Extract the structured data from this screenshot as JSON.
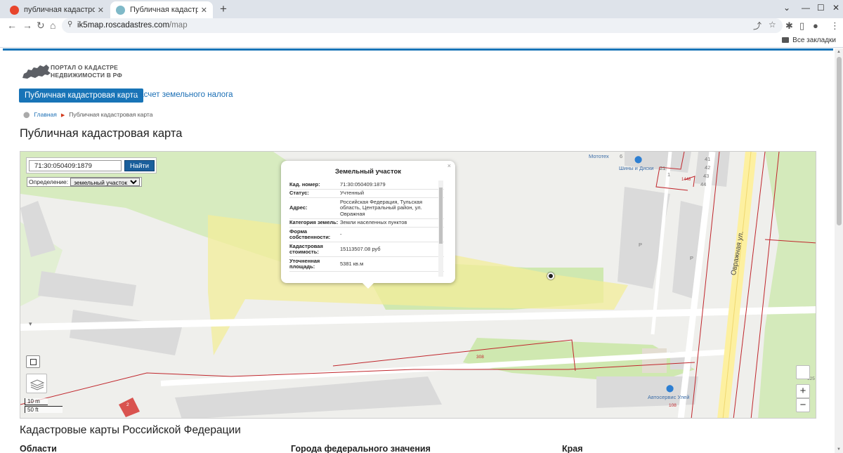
{
  "browser": {
    "tabs": [
      {
        "title": "публичная кадастровая ка",
        "active": false
      },
      {
        "title": "Публичная кадастровая ка",
        "active": true
      }
    ],
    "url_host": "ik5map.roscadastres.com",
    "url_path": "/map",
    "bookmarks_label": "Все закладки"
  },
  "site": {
    "logo_line1": "ПОРТАЛ О КАДАСТРЕ",
    "logo_line2": "НЕДВИЖИМОСТИ В РФ",
    "nav": [
      "Публичная кадастровая карта",
      "Расчет земельного налога"
    ],
    "breadcrumb": {
      "home": "Главная",
      "current": "Публичная кадастровая карта"
    },
    "title": "Публичная кадастровая карта"
  },
  "map": {
    "search_value": "71:30:050409:1879",
    "search_button": "Найти",
    "definition_label": "Определение:",
    "definition_selected": "земельный участок",
    "scale_m": "10 m",
    "scale_ft": "50 ft",
    "zoom_in": "+",
    "zoom_out": "−",
    "labels": {
      "shop1": "Мототех",
      "shop2": "Шины и Диски",
      "n6": "6",
      "n21": "21",
      "n1": "1",
      "n41": "41",
      "n42": "42",
      "n43": "43",
      "n44": "44",
      "n1448": "1448",
      "p1": "P",
      "p2": "P",
      "street": "Овражная ул.",
      "n308": "308",
      "n2": "2",
      "n125": "125",
      "n108": "108",
      "autoservice": "Автосервис Улей"
    },
    "popup": {
      "title": "Земельный участок",
      "close": "×",
      "rows": [
        {
          "key": "Кад. номер:",
          "value": "71:30:050409:1879"
        },
        {
          "key": "Статус:",
          "value": "Учтенный"
        },
        {
          "key": "Адрес:",
          "value": "Российская Федерация, Тульская область, Центральный район, ул. Овражная"
        },
        {
          "key": "Категория земель:",
          "value": "Земли населенных пунктов"
        },
        {
          "key": "Форма собственности:",
          "value": "-"
        },
        {
          "key": "Кадастровая стоимость:",
          "value": "15113507.08 руб"
        },
        {
          "key": "Уточненная площадь:",
          "value": "5381 кв.м"
        }
      ]
    }
  },
  "below": {
    "section_title": "Кадастровые карты Российской Федерации",
    "columns": [
      "Области",
      "Города федерального значения",
      "Края"
    ]
  },
  "colors": {
    "brand_blue": "#1874b7",
    "parcel_fill": "#f3ee9a",
    "boundary_red": "#c0262c"
  }
}
